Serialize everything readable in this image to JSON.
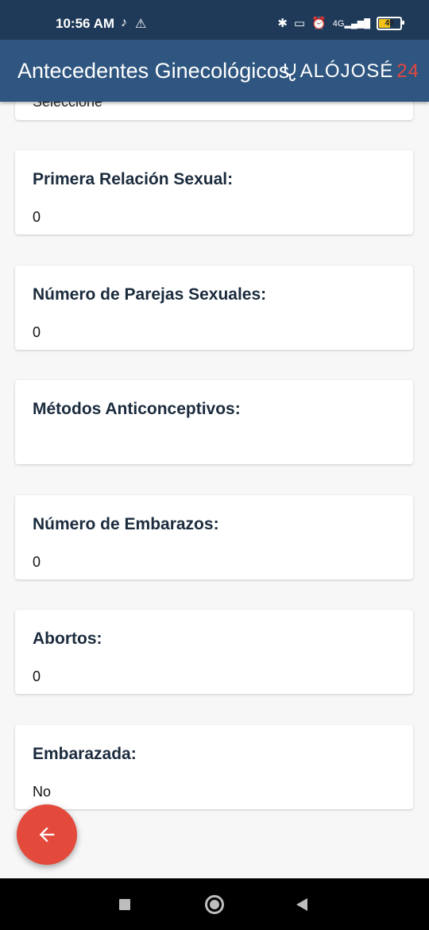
{
  "status_bar": {
    "time": "10:56 AM",
    "battery": "49",
    "icons": [
      "tiktok-icon",
      "warning-icon",
      "bluetooth-icon",
      "vibrate-icon",
      "alarm-off-icon",
      "signal-icon",
      "battery-icon"
    ],
    "signal_label": "4G"
  },
  "app_bar": {
    "title": "Antecedentes Ginecológicos",
    "logo_text": "ALÓJOSÉ",
    "logo_number": "24"
  },
  "top_partial": {
    "value": "Seleccione"
  },
  "cards": [
    {
      "label": "Primera Relación Sexual:",
      "value": "0"
    },
    {
      "label": "Número de Parejas Sexuales:",
      "value": "0"
    },
    {
      "label": "Métodos Anticonceptivos:",
      "value": ""
    },
    {
      "label": "Número de Embarazos:",
      "value": "0"
    },
    {
      "label": "Abortos:",
      "value": "0"
    },
    {
      "label": "Embarazada:",
      "value": "No"
    }
  ],
  "fab": {
    "icon": "arrow-back-icon"
  },
  "nav_bar": {
    "icons": [
      "recents-icon",
      "home-icon",
      "back-icon"
    ]
  },
  "colors": {
    "status_bar": "#1f3a59",
    "app_bar": "#2f5680",
    "fab": "#e34a3b",
    "logo_accent": "#e0473f",
    "background": "#f7f7f7"
  }
}
